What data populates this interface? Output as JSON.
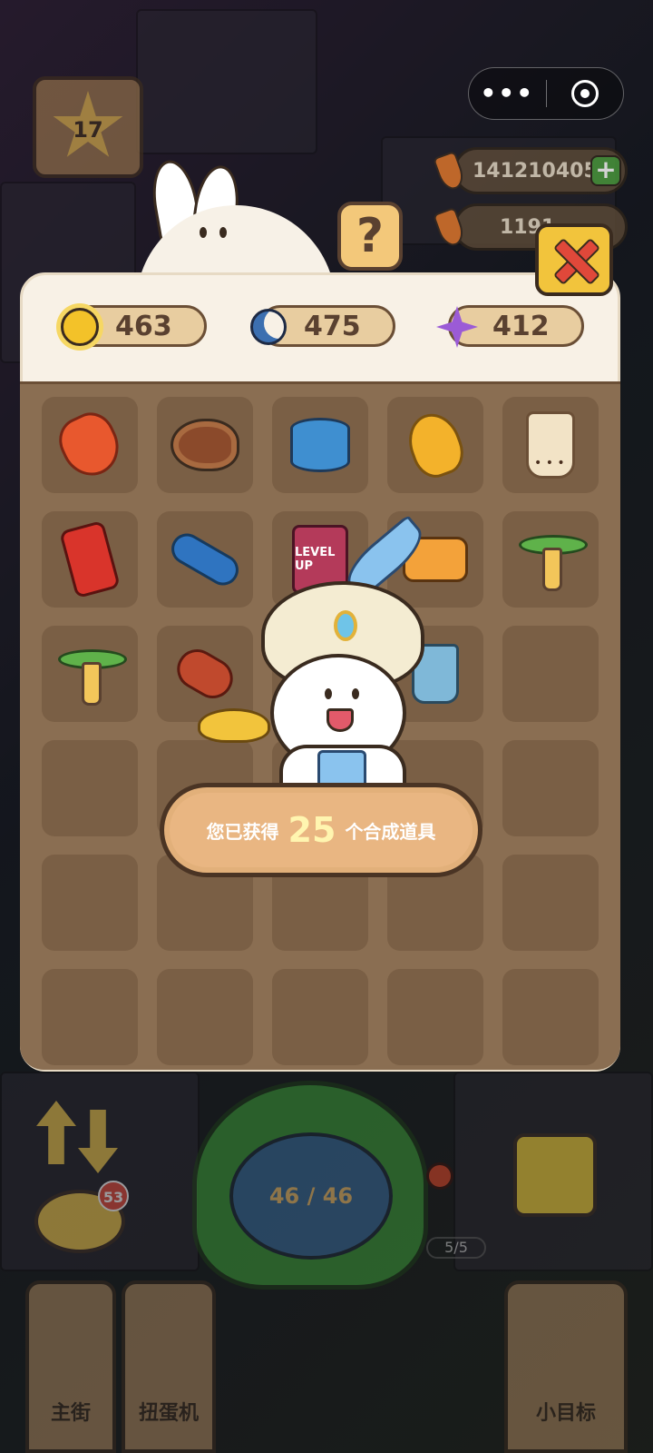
{
  "top_bar": {
    "menu_dots": "•••",
    "level": "17",
    "carrot_count": "141210405",
    "second_count": "1191"
  },
  "panel": {
    "help_label": "?",
    "resources": [
      {
        "icon": "sun-icon",
        "value": "463"
      },
      {
        "icon": "moon-icon",
        "value": "475"
      },
      {
        "icon": "purple-star-icon",
        "value": "412"
      }
    ],
    "items": [
      {
        "icon": "lobster-icon"
      },
      {
        "icon": "steak-icon"
      },
      {
        "icon": "canned-fish-icon"
      },
      {
        "icon": "fried-chicken-icon"
      },
      {
        "icon": "boba-tea-icon"
      },
      {
        "icon": "cola-can-icon"
      },
      {
        "icon": "skateboard-icon"
      },
      {
        "icon": "handheld-game-icon",
        "label": "LEVEL UP"
      },
      {
        "icon": "water-gun-icon"
      },
      {
        "icon": "propeller-icon"
      },
      {
        "icon": "propeller-icon"
      },
      {
        "icon": "sausage-icon"
      },
      {
        "icon": "empty"
      },
      {
        "icon": "blue-cup-icon"
      },
      {
        "icon": "empty"
      },
      {
        "icon": "empty"
      },
      {
        "icon": "empty"
      },
      {
        "icon": "empty"
      },
      {
        "icon": "empty"
      },
      {
        "icon": "empty"
      },
      {
        "icon": "empty"
      },
      {
        "icon": "empty"
      },
      {
        "icon": "empty"
      },
      {
        "icon": "empty"
      },
      {
        "icon": "empty"
      },
      {
        "icon": "empty"
      },
      {
        "icon": "empty"
      },
      {
        "icon": "empty"
      },
      {
        "icon": "empty"
      },
      {
        "icon": "empty"
      }
    ]
  },
  "reward": {
    "prefix": "您已获得",
    "count": "25",
    "suffix": "个合成道具"
  },
  "bottom": {
    "badge_count": "53",
    "gacha_count": "46 / 46",
    "joystick_count": "5/5",
    "tabs": [
      "主街",
      "扭蛋机",
      "小目标"
    ]
  },
  "colors": {
    "panel_bg": "#f8f1e6",
    "grid_bg": "#8a6e52",
    "close_button": "#f2c43c",
    "banner": "#e9b682"
  }
}
